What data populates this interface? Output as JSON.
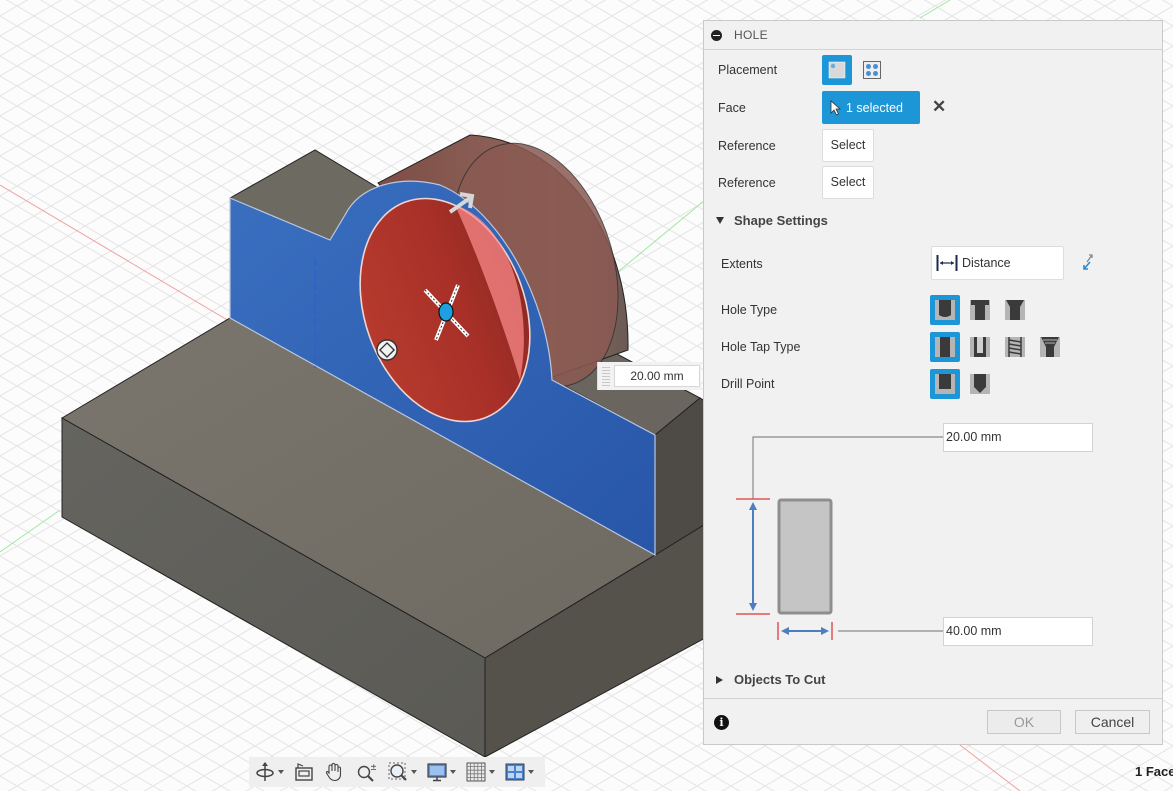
{
  "viewport": {
    "canvas_dimension_value": "20.00 mm",
    "status_selection": "1 Face"
  },
  "panel": {
    "title": "HOLE",
    "rows": {
      "placement_label": "Placement",
      "face_label": "Face",
      "face_value": "1 selected",
      "reference1_label": "Reference",
      "reference1_value": "Select",
      "reference2_label": "Reference",
      "reference2_value": "Select"
    },
    "shape_settings": {
      "title": "Shape Settings",
      "expanded": true,
      "extents_label": "Extents",
      "extents_value": "Distance",
      "hole_type_label": "Hole Type",
      "hole_type_options": [
        "Simple",
        "Counterbore",
        "Countersink"
      ],
      "hole_type_selected": "Simple",
      "hole_tap_type_label": "Hole Tap Type",
      "hole_tap_type_options": [
        "Simple",
        "Clearance",
        "Tapped",
        "Taper Tapped"
      ],
      "hole_tap_type_selected": "Simple",
      "drill_point_label": "Drill Point",
      "drill_point_options": [
        "Flat",
        "Angle"
      ],
      "drill_point_selected": "Flat",
      "diameter_value": "20.00 mm",
      "depth_value": "40.00 mm"
    },
    "objects_to_cut": {
      "title": "Objects To Cut",
      "expanded": false
    },
    "footer": {
      "ok_label": "OK",
      "cancel_label": "Cancel"
    }
  },
  "toolbar": {
    "items": [
      "orbit",
      "look-at",
      "pan",
      "zoom",
      "fit",
      "display-settings",
      "grid-settings",
      "viewports"
    ]
  },
  "colors": {
    "accent": "#1c96d6",
    "selected_face": "#2f66b8",
    "hole_preview": "#c8443a",
    "body": "#6f6b63"
  }
}
